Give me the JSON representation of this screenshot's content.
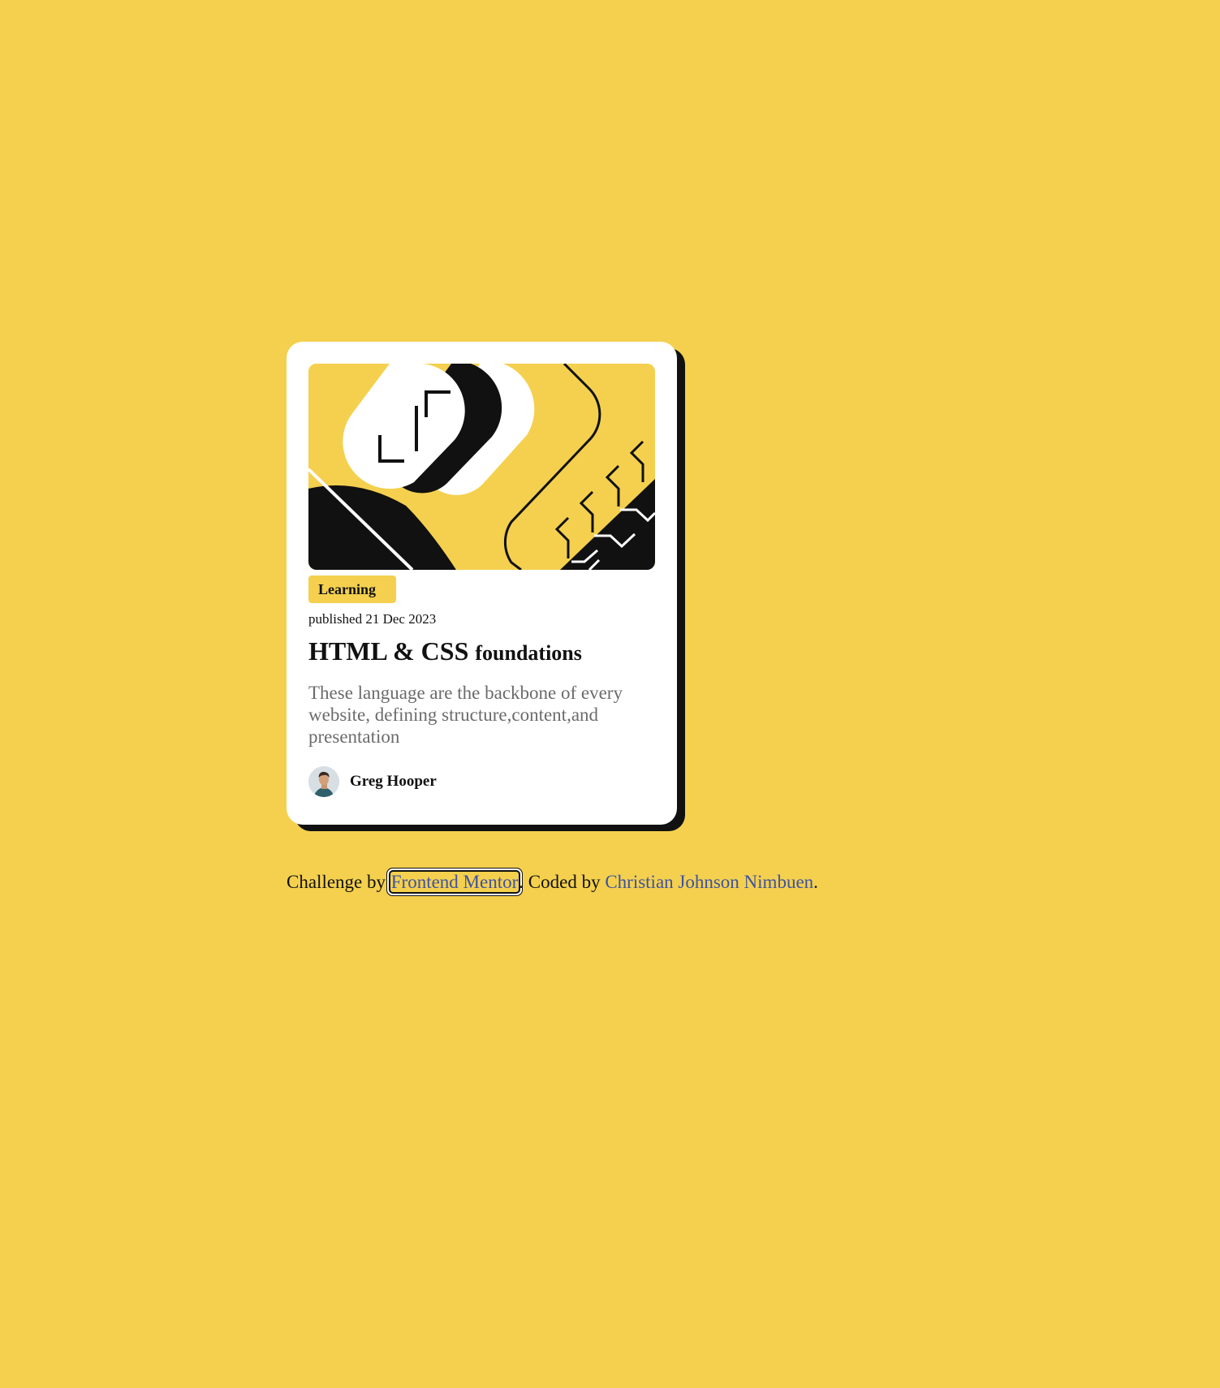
{
  "card": {
    "tag": "Learning",
    "published": "published 21 Dec 2023",
    "title_main": "HTML & CSS",
    "title_rest": "foundations",
    "description": "These language are the backbone of every website, defining structure,content,and presentation",
    "author_name": "Greg Hooper"
  },
  "attribution": {
    "prefix": "Challenge by",
    "challenge_link": "Frontend Mentor",
    "middle": ". Coded by",
    "author_link": "Christian Johnson Nimbuen",
    "suffix": "."
  },
  "colors": {
    "background": "#f4d04e",
    "card": "#ffffff",
    "shadow": "#111111",
    "link": "#3e52a3",
    "muted_text": "#6b6b6b"
  },
  "icons": {
    "hero": "abstract-illustration",
    "avatar": "avatar-photo"
  }
}
